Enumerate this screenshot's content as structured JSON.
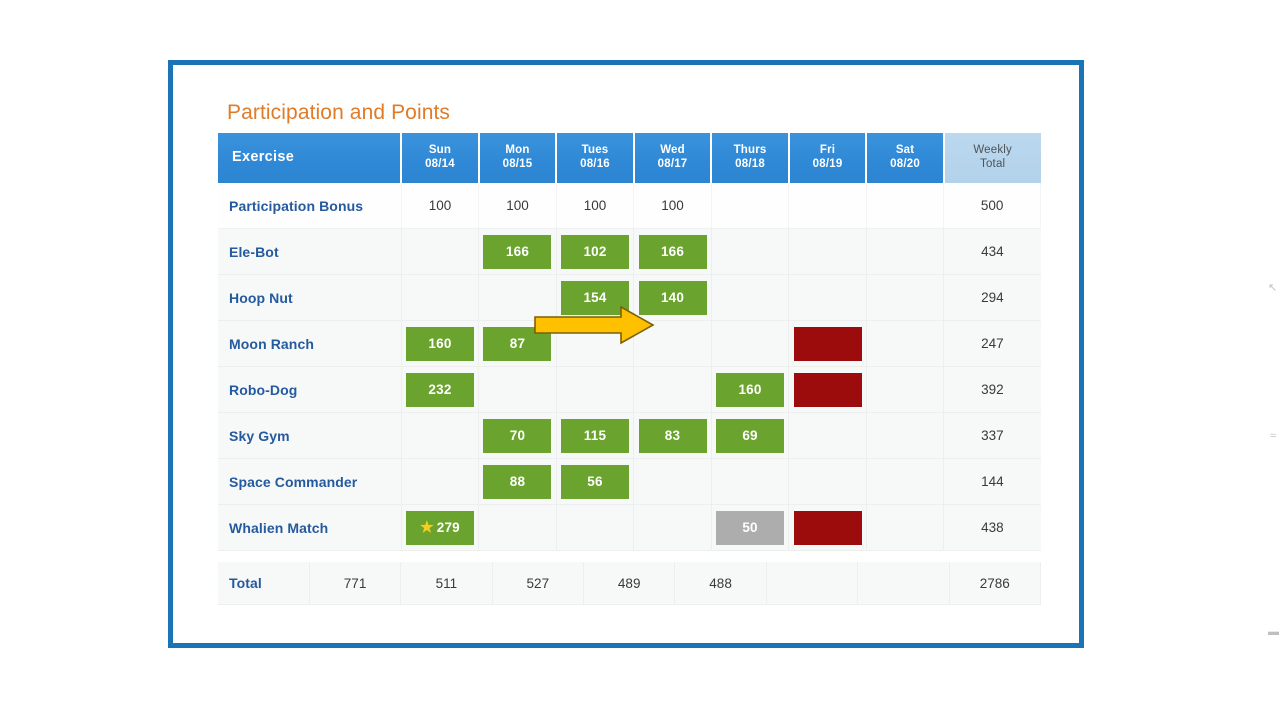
{
  "slide": {
    "title": "Participation and Points",
    "frame_color": "#1B74B5",
    "title_color": "#E07B28"
  },
  "table": {
    "columns": [
      {
        "label": "Exercise",
        "day": "Exercise",
        "date": ""
      },
      {
        "label": "Sun 08/14",
        "day": "Sun",
        "date": "08/14"
      },
      {
        "label": "Mon 08/15",
        "day": "Mon",
        "date": "08/15"
      },
      {
        "label": "Tues 08/16",
        "day": "Tues",
        "date": "08/16"
      },
      {
        "label": "Wed 08/17",
        "day": "Wed",
        "date": "08/17"
      },
      {
        "label": "Thurs 08/18",
        "day": "Thurs",
        "date": "08/18"
      },
      {
        "label": "Fri 08/19",
        "day": "Fri",
        "date": "08/19"
      },
      {
        "label": "Sat 08/20",
        "day": "Sat",
        "date": "08/20"
      },
      {
        "label": "Weekly Total",
        "day": "Weekly",
        "date": "Total"
      }
    ],
    "colors": {
      "header_blue": "#2F89D6",
      "header_total_blue": "#B6D4EC",
      "green": "#6AA32E",
      "dark_red": "#9C0C0C",
      "gray": "#ADADAD",
      "label_blue": "#255A9E",
      "arrow_fill": "#FFC000",
      "arrow_outline": "#7C6000",
      "star": "#F2D023"
    },
    "rows": [
      {
        "name": "Participation Bonus",
        "plain": true,
        "cells": [
          {
            "text": "100",
            "style": "plain"
          },
          {
            "text": "100",
            "style": "plain"
          },
          {
            "text": "100",
            "style": "plain"
          },
          {
            "text": "100",
            "style": "plain"
          },
          {
            "text": "",
            "style": "empty"
          },
          {
            "text": "",
            "style": "empty"
          },
          {
            "text": "",
            "style": "empty"
          }
        ],
        "total": "500"
      },
      {
        "name": "Ele-Bot",
        "plain": false,
        "cells": [
          {
            "text": "",
            "style": "empty"
          },
          {
            "text": "166",
            "style": "green"
          },
          {
            "text": "102",
            "style": "green"
          },
          {
            "text": "166",
            "style": "green"
          },
          {
            "text": "",
            "style": "empty"
          },
          {
            "text": "",
            "style": "empty"
          },
          {
            "text": "",
            "style": "empty"
          }
        ],
        "total": "434"
      },
      {
        "name": "Hoop Nut",
        "plain": false,
        "cells": [
          {
            "text": "",
            "style": "empty"
          },
          {
            "text": "",
            "style": "empty"
          },
          {
            "text": "154",
            "style": "green"
          },
          {
            "text": "140",
            "style": "green"
          },
          {
            "text": "",
            "style": "empty"
          },
          {
            "text": "",
            "style": "empty"
          },
          {
            "text": "",
            "style": "empty"
          }
        ],
        "total": "294"
      },
      {
        "name": "Moon Ranch",
        "plain": false,
        "cells": [
          {
            "text": "160",
            "style": "green"
          },
          {
            "text": "87",
            "style": "green"
          },
          {
            "text": "",
            "style": "empty"
          },
          {
            "text": "",
            "style": "empty"
          },
          {
            "text": "",
            "style": "empty"
          },
          {
            "text": "",
            "style": "red"
          },
          {
            "text": "",
            "style": "empty"
          }
        ],
        "total": "247"
      },
      {
        "name": "Robo-Dog",
        "plain": false,
        "cells": [
          {
            "text": "232",
            "style": "green"
          },
          {
            "text": "",
            "style": "empty"
          },
          {
            "text": "",
            "style": "empty"
          },
          {
            "text": "",
            "style": "empty"
          },
          {
            "text": "160",
            "style": "green"
          },
          {
            "text": "",
            "style": "red"
          },
          {
            "text": "",
            "style": "empty"
          }
        ],
        "total": "392"
      },
      {
        "name": "Sky Gym",
        "plain": false,
        "cells": [
          {
            "text": "",
            "style": "empty"
          },
          {
            "text": "70",
            "style": "green"
          },
          {
            "text": "115",
            "style": "green"
          },
          {
            "text": "83",
            "style": "green"
          },
          {
            "text": "69",
            "style": "green"
          },
          {
            "text": "",
            "style": "empty"
          },
          {
            "text": "",
            "style": "empty"
          }
        ],
        "total": "337"
      },
      {
        "name": "Space Commander",
        "plain": false,
        "cells": [
          {
            "text": "",
            "style": "empty"
          },
          {
            "text": "88",
            "style": "green"
          },
          {
            "text": "56",
            "style": "green"
          },
          {
            "text": "",
            "style": "empty"
          },
          {
            "text": "",
            "style": "empty"
          },
          {
            "text": "",
            "style": "empty"
          },
          {
            "text": "",
            "style": "empty"
          }
        ],
        "total": "144"
      },
      {
        "name": "Whalien Match",
        "plain": false,
        "cells": [
          {
            "text": "279",
            "style": "green",
            "star": true
          },
          {
            "text": "",
            "style": "empty"
          },
          {
            "text": "",
            "style": "empty"
          },
          {
            "text": "",
            "style": "empty"
          },
          {
            "text": "50",
            "style": "gray"
          },
          {
            "text": "",
            "style": "red"
          },
          {
            "text": "",
            "style": "empty"
          }
        ],
        "total": "438"
      }
    ],
    "total_row": {
      "label": "Total",
      "values": [
        "771",
        "511",
        "527",
        "489",
        "488",
        "",
        ""
      ],
      "grand_total": "2786"
    }
  },
  "annotation": {
    "arrow_name": "right-block-arrow",
    "points_at": "Ele-Bot Mon 08/15 cell"
  },
  "icons": {
    "star_glyph": "★"
  }
}
